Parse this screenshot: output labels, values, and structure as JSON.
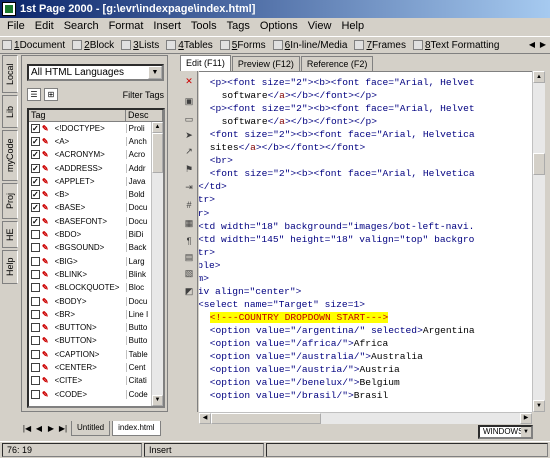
{
  "window": {
    "title": "1st Page 2000 - [g:\\evr\\indexpage\\index.html]"
  },
  "menu": [
    "File",
    "Edit",
    "Search",
    "Format",
    "Insert",
    "Tools",
    "Tags",
    "Options",
    "View",
    "Help"
  ],
  "toolbar_tabs": [
    {
      "num": "1",
      "label": "Document"
    },
    {
      "num": "2",
      "label": "Block"
    },
    {
      "num": "3",
      "label": "Lists"
    },
    {
      "num": "4",
      "label": "Tables"
    },
    {
      "num": "5",
      "label": "Forms"
    },
    {
      "num": "6",
      "label": "In-line/Media"
    },
    {
      "num": "7",
      "label": "Frames"
    },
    {
      "num": "8",
      "label": "Text Formatting"
    }
  ],
  "left_tabs": [
    "Local",
    "Lib",
    "myCode",
    "Proj",
    "HE",
    "Help"
  ],
  "tag_panel": {
    "language": "All HTML Languages",
    "filter_label": "Filter Tags",
    "col_tag": "Tag",
    "col_desc": "Desc",
    "rows": [
      {
        "tag": "<!DOCTYPE>",
        "desc": "Proli",
        "checked": true
      },
      {
        "tag": "<A>",
        "desc": "Anch",
        "checked": true
      },
      {
        "tag": "<ACRONYM>",
        "desc": "Acro",
        "checked": true
      },
      {
        "tag": "<ADDRESS>",
        "desc": "Addr",
        "checked": true
      },
      {
        "tag": "<APPLET>",
        "desc": "Java",
        "checked": true
      },
      {
        "tag": "<B>",
        "desc": "Bold",
        "checked": true
      },
      {
        "tag": "<BASE>",
        "desc": "Docu",
        "checked": true
      },
      {
        "tag": "<BASEFONT>",
        "desc": "Docu",
        "checked": true
      },
      {
        "tag": "<BDO>",
        "desc": "BiDi",
        "checked": false
      },
      {
        "tag": "<BGSOUND>",
        "desc": "Back",
        "checked": false
      },
      {
        "tag": "<BIG>",
        "desc": "Larg",
        "checked": false
      },
      {
        "tag": "<BLINK>",
        "desc": "Blink",
        "checked": false
      },
      {
        "tag": "<BLOCKQUOTE>",
        "desc": "Bloc",
        "checked": false
      },
      {
        "tag": "<BODY>",
        "desc": "Docu",
        "checked": false
      },
      {
        "tag": "<BR>",
        "desc": "Line I",
        "checked": false
      },
      {
        "tag": "<BUTTON>",
        "desc": "Butto",
        "checked": false
      },
      {
        "tag": "<BUTTON>",
        "desc": "Butto",
        "checked": false
      },
      {
        "tag": "<CAPTION>",
        "desc": "Table",
        "checked": false
      },
      {
        "tag": "<CENTER>",
        "desc": "Cent",
        "checked": false
      },
      {
        "tag": "<CITE>",
        "desc": "Citati",
        "checked": false
      },
      {
        "tag": "<CODE>",
        "desc": "Code",
        "checked": false
      }
    ]
  },
  "editor_tabs": [
    "Edit (F11)",
    "Preview (F12)",
    "Reference (F2)"
  ],
  "code_lines": [
    {
      "indent": 6,
      "segs": [
        [
          "tag",
          "<p><font size="
        ],
        [
          "str",
          "\"2\""
        ],
        [
          "tag",
          "><b><font face="
        ],
        [
          "str",
          "\"Arial, Helvet"
        ]
      ]
    },
    {
      "indent": 7,
      "segs": [
        [
          "txt",
          "software"
        ],
        [
          "tag",
          "</"
        ],
        [
          "attr",
          "a"
        ],
        [
          "tag",
          "></b></font></p>"
        ]
      ]
    },
    {
      "indent": 6,
      "segs": [
        [
          "tag",
          "<p><font size="
        ],
        [
          "str",
          "\"2\""
        ],
        [
          "tag",
          "><b><font face="
        ],
        [
          "str",
          "\"Arial, Helvet"
        ]
      ]
    },
    {
      "indent": 7,
      "segs": [
        [
          "txt",
          "software"
        ],
        [
          "tag",
          "</"
        ],
        [
          "attr",
          "a"
        ],
        [
          "tag",
          "></b></font></p>"
        ]
      ]
    },
    {
      "indent": 6,
      "segs": [
        [
          "tag",
          "<font size="
        ],
        [
          "str",
          "\"2\""
        ],
        [
          "tag",
          "><b><font face="
        ],
        [
          "str",
          "\"Arial, Helvetica"
        ]
      ]
    },
    {
      "indent": 6,
      "segs": [
        [
          "txt",
          "sites"
        ],
        [
          "tag",
          "</"
        ],
        [
          "attr",
          "a"
        ],
        [
          "tag",
          "></b></font></font>"
        ]
      ]
    },
    {
      "indent": 6,
      "segs": [
        [
          "tag",
          "<br>"
        ]
      ]
    },
    {
      "indent": 6,
      "segs": [
        [
          "tag",
          "<font size="
        ],
        [
          "str",
          "\"2\""
        ],
        [
          "tag",
          "><b><font face="
        ],
        [
          "str",
          "\"Arial, Helvetica"
        ]
      ]
    },
    {
      "indent": 5,
      "segs": [
        [
          "tag",
          "</td>"
        ]
      ]
    },
    {
      "indent": 4,
      "segs": [
        [
          "tag",
          "</tr>"
        ]
      ]
    },
    {
      "indent": 4,
      "segs": [
        [
          "tag",
          "<tr>"
        ]
      ]
    },
    {
      "indent": 5,
      "segs": [
        [
          "tag",
          "<td width="
        ],
        [
          "str",
          "\"18\""
        ],
        [
          "tag",
          " background="
        ],
        [
          "str",
          "\"images/bot-left-navi."
        ]
      ]
    },
    {
      "indent": 5,
      "segs": [
        [
          "tag",
          "<td width="
        ],
        [
          "str",
          "\"145\""
        ],
        [
          "tag",
          " height="
        ],
        [
          "str",
          "\"18\""
        ],
        [
          "tag",
          " valign="
        ],
        [
          "str",
          "\"top\""
        ],
        [
          "tag",
          " backgro"
        ]
      ]
    },
    {
      "indent": 4,
      "segs": [
        [
          "tag",
          "</tr>"
        ]
      ]
    },
    {
      "indent": 3,
      "segs": [
        [
          "tag",
          "</table>"
        ]
      ]
    },
    {
      "indent": 3,
      "segs": [
        [
          "tag",
          "<form>"
        ]
      ]
    },
    {
      "indent": 4,
      "segs": [
        [
          "tag",
          "<div align="
        ],
        [
          "str",
          "\"center\""
        ],
        [
          "tag",
          ">"
        ]
      ]
    },
    {
      "indent": 5,
      "segs": [
        [
          "tag",
          "<select name="
        ],
        [
          "str",
          "\"Target\""
        ],
        [
          "tag",
          " size="
        ],
        [
          "str",
          "1"
        ],
        [
          "tag",
          ">"
        ]
      ]
    },
    {
      "indent": 6,
      "segs": [
        [
          "hl",
          "<!---COUNTRY DROPDOWN START--->"
        ]
      ]
    },
    {
      "indent": 6,
      "segs": [
        [
          "tag",
          "<option value="
        ],
        [
          "str",
          "\"/argentina/\""
        ],
        [
          "tag",
          " selected>"
        ],
        [
          "txt",
          "Argentina"
        ]
      ]
    },
    {
      "indent": 6,
      "segs": [
        [
          "tag",
          "<option value="
        ],
        [
          "str",
          "\"/africa/\""
        ],
        [
          "tag",
          ">"
        ],
        [
          "txt",
          "Africa"
        ]
      ]
    },
    {
      "indent": 6,
      "segs": [
        [
          "tag",
          "<option value="
        ],
        [
          "str",
          "\"/australia/\""
        ],
        [
          "tag",
          ">"
        ],
        [
          "txt",
          "Australia"
        ]
      ]
    },
    {
      "indent": 6,
      "segs": [
        [
          "tag",
          "<option value="
        ],
        [
          "str",
          "\"/austria/\""
        ],
        [
          "tag",
          ">"
        ],
        [
          "txt",
          "Austria"
        ]
      ]
    },
    {
      "indent": 6,
      "segs": [
        [
          "tag",
          "<option value="
        ],
        [
          "str",
          "\"/benelux/\""
        ],
        [
          "tag",
          ">"
        ],
        [
          "txt",
          "Belgium"
        ]
      ]
    },
    {
      "indent": 6,
      "segs": [
        [
          "tag",
          "<option value="
        ],
        [
          "str",
          "\"/brasil/\""
        ],
        [
          "tag",
          ">"
        ],
        [
          "txt",
          "Brasil"
        ]
      ]
    }
  ],
  "doc_tabs": [
    "Untitled",
    "index.html"
  ],
  "mode_select": "WINDOWS",
  "status": {
    "position": "76: 19",
    "mode": "Insert"
  }
}
